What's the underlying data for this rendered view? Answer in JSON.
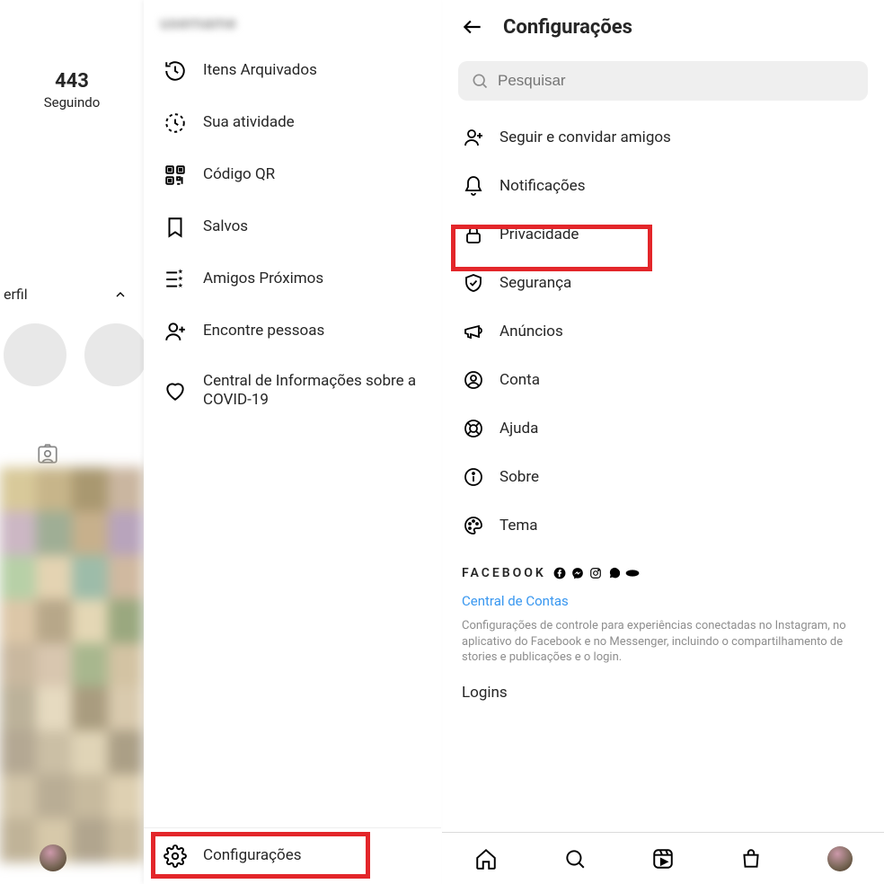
{
  "left": {
    "username_blurred": "username",
    "stat_count": "443",
    "stat_label": "Seguindo",
    "profile_row_label": "erfil",
    "menu": [
      {
        "icon": "clock-history-icon",
        "label": "Itens Arquivados"
      },
      {
        "icon": "activity-clock-icon",
        "label": "Sua atividade"
      },
      {
        "icon": "qr-icon",
        "label": "Código QR"
      },
      {
        "icon": "bookmark-icon",
        "label": "Salvos"
      },
      {
        "icon": "close-friends-icon",
        "label": "Amigos Próximos"
      },
      {
        "icon": "add-person-icon",
        "label": "Encontre pessoas"
      },
      {
        "icon": "heart-icon",
        "label": "Central de Informações sobre a COVID-19"
      }
    ],
    "settings_label": "Configurações"
  },
  "right": {
    "header": "Configurações",
    "search_placeholder": "Pesquisar",
    "items": [
      {
        "icon": "add-person-icon",
        "label": "Seguir e convidar amigos"
      },
      {
        "icon": "bell-icon",
        "label": "Notificações"
      },
      {
        "icon": "lock-icon",
        "label": "Privacidade"
      },
      {
        "icon": "shield-check-icon",
        "label": "Segurança"
      },
      {
        "icon": "megaphone-icon",
        "label": "Anúncios"
      },
      {
        "icon": "account-icon",
        "label": "Conta"
      },
      {
        "icon": "lifebuoy-icon",
        "label": "Ajuda"
      },
      {
        "icon": "info-icon",
        "label": "Sobre"
      },
      {
        "icon": "palette-icon",
        "label": "Tema"
      }
    ],
    "facebook_label": "FACEBOOK",
    "central_link": "Central de Contas",
    "description": "Configurações de controle para experiências conectadas no Instagram, no aplicativo do Facebook e no Messenger, incluindo o compartilhamento de stories e publicações e o login.",
    "logins_label": "Logins"
  }
}
